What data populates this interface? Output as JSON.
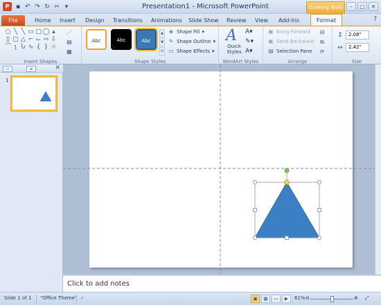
{
  "app": {
    "title": "Presentation1 - Microsoft PowerPoint",
    "icon_letter": "P",
    "context_tab_group": "Drawing Tools",
    "window_buttons": [
      "–",
      "□",
      "✕"
    ],
    "help_icon": "?"
  },
  "tabs": {
    "file": "File",
    "items": [
      {
        "label": "Home"
      },
      {
        "label": "Insert"
      },
      {
        "label": "Design"
      },
      {
        "label": "Transitions"
      },
      {
        "label": "Animations"
      },
      {
        "label": "Slide Show"
      },
      {
        "label": "Review"
      },
      {
        "label": "View"
      },
      {
        "label": "Add-Ins"
      }
    ],
    "active": "Format"
  },
  "ribbon": {
    "insert_shapes": {
      "label": "Insert Shapes"
    },
    "shape_styles": {
      "label": "Shape Styles",
      "swatch_text": "Abc",
      "fill": "Shape Fill",
      "outline": "Shape Outline",
      "effects": "Shape Effects"
    },
    "wordart": {
      "label": "WordArt Styles",
      "quick_styles": "Quick Styles"
    },
    "arrange": {
      "label": "Arrange",
      "bring_forward": "Bring Forward",
      "send_backward": "Send Backward",
      "selection_pane": "Selection Pane"
    },
    "size": {
      "label": "Size",
      "height": "2.08\"",
      "width": "2.42\""
    }
  },
  "panel": {
    "slide_number": "1"
  },
  "notes": {
    "placeholder": "Click to add notes"
  },
  "status": {
    "slide": "Slide 1 of 1",
    "theme": "\"Office Theme\"",
    "zoom": "61%"
  },
  "colors": {
    "shape_fill": "#3b7fc4",
    "shape_outline": "#2e6aa8",
    "accent_orange": "#e9753c",
    "context_gold": "#f0a93a"
  }
}
